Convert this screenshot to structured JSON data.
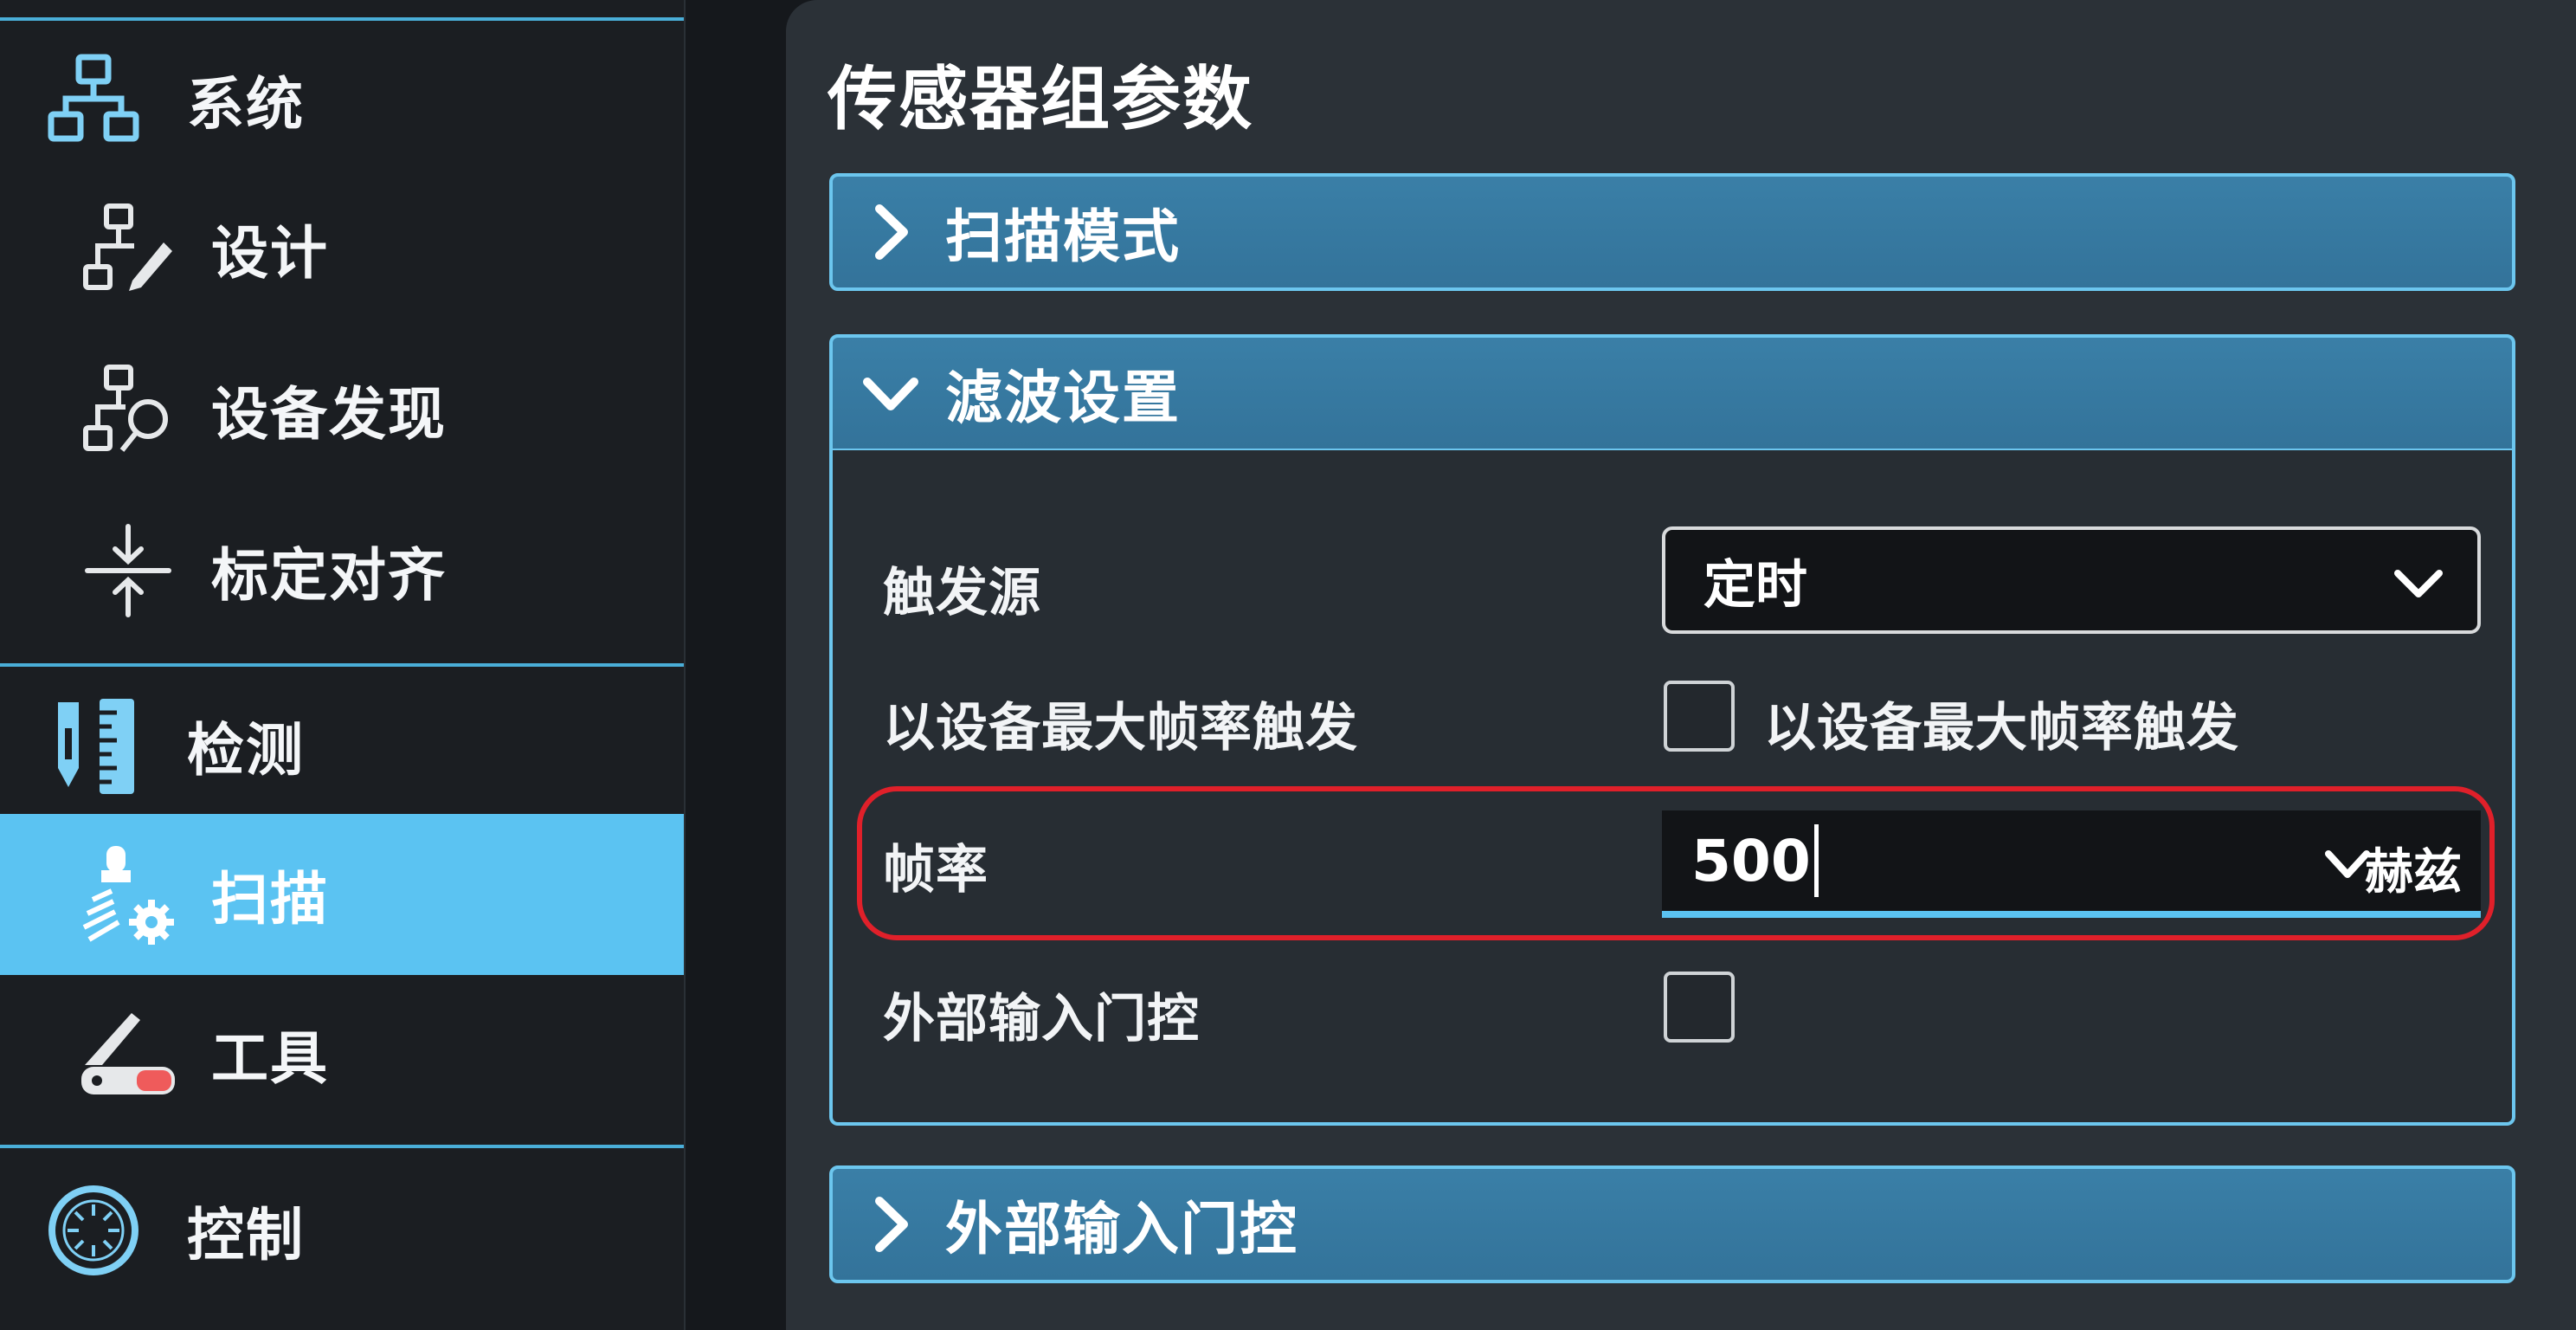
{
  "sidebar": {
    "items": [
      {
        "label": "系统",
        "icon": "network-hierarchy-icon"
      },
      {
        "label": "设计",
        "icon": "hierarchy-edit-icon"
      },
      {
        "label": "设备发现",
        "icon": "hierarchy-search-icon"
      },
      {
        "label": "标定对齐",
        "icon": "align-arrows-icon"
      },
      {
        "label": "检测",
        "icon": "ruler-probe-icon"
      },
      {
        "label": "扫描",
        "icon": "scan-gear-icon"
      },
      {
        "label": "工具",
        "icon": "knife-tool-icon"
      },
      {
        "label": "控制",
        "icon": "dial-icon"
      }
    ],
    "active_label": "扫描"
  },
  "main": {
    "title": "传感器组参数",
    "sections": [
      {
        "label": "扫描模式",
        "expanded": false
      },
      {
        "label": "滤波设置",
        "expanded": true
      },
      {
        "label": "外部输入门控",
        "expanded": false
      }
    ],
    "filter": {
      "trigger_source": {
        "label": "触发源",
        "value": "定时"
      },
      "max_rate": {
        "label": "以设备最大帧率触发",
        "checkbox_label": "以设备最大帧率触发",
        "checked": false
      },
      "frame_rate": {
        "label": "帧率",
        "value": "500",
        "unit": "赫兹"
      },
      "ext_gate": {
        "label": "外部输入门控",
        "checked": false
      }
    }
  },
  "colors": {
    "accent": "#5bc3f2",
    "header_fill": "#3a7fa7",
    "highlight": "#e0202a",
    "sidebar_bg": "#1b1e22",
    "panel_bg": "#2b3137"
  }
}
